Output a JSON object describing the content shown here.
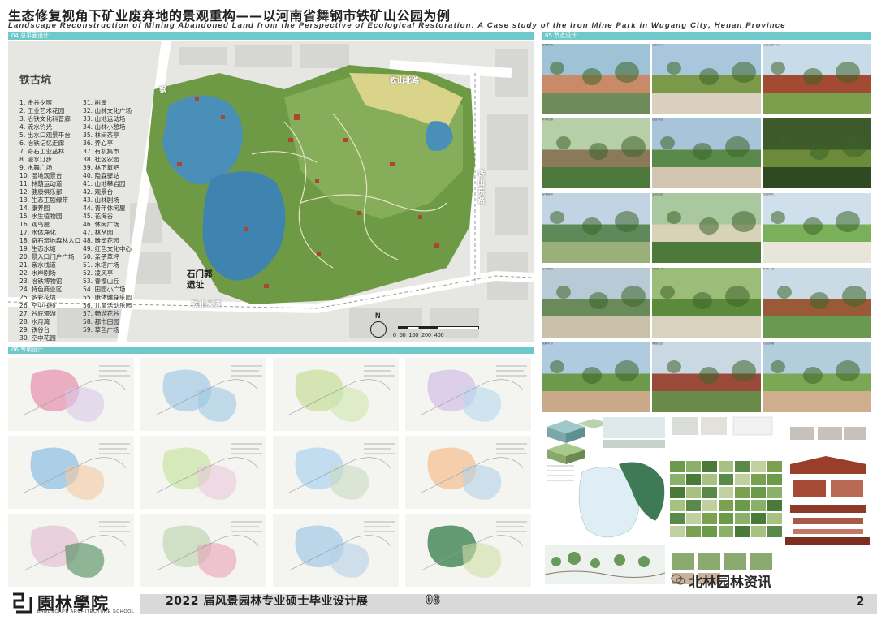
{
  "header": {
    "title_cn": "生态修复视角下矿业废弃地的景观重构——以河南省舞钢市铁矿山公园为例",
    "title_en": "Landscape Reconstruction of Mining Abandoned Land from the Perspective of Ecological Restoration: A Case study of the Iron Mine Park in Wugang City, Henan Province"
  },
  "sections": {
    "plan_title": "04 总平面设计",
    "photos_title": "05 节点设计",
    "special_title": "06 专项设计"
  },
  "plan": {
    "legend_title": "铁古坑",
    "legend_left": [
      "1. 金谷夕照",
      "2. 工业艺术花园",
      "3. 冶铁文化科普廊",
      "4. 流水钓光",
      "5. 出水口观景平台",
      "6. 冶铁记忆走廊",
      "7. 奇石工业丛林",
      "8. 漫水汀步",
      "9. 水舞广场",
      "10. 湿地观景台",
      "11. 林荫运动道",
      "12. 健康俱乐部",
      "13. 生态正剧绿带",
      "14. 康养园",
      "15. 水生植物园",
      "16. 观鸟屋",
      "17. 水体净化",
      "18. 奇石湿地森林入口",
      "19. 生态水塘",
      "20. 景入口门户广场",
      "21. 亲水栈道",
      "22. 水岸剧场",
      "23. 冶铁博物馆",
      "24. 特色商业区",
      "25. 多彩花境",
      "26. 空中栈桥",
      "27. 谷底漫游",
      "28. 水月湾",
      "29. 铁谷台",
      "30. 空中花园"
    ],
    "legend_right": [
      "31. 树屋",
      "32. 山林文化广场",
      "33. 山地运动场",
      "34. 山林小憩场",
      "35. 林间茶亭",
      "36. 养心亭",
      "37. 有机集市",
      "38. 社区农园",
      "39. 林下氧吧",
      "40. 隐森驿站",
      "41. 山地攀岩园",
      "42. 观景台",
      "43. 山林剧场",
      "44. 青年休闲屋",
      "45. 花海谷",
      "46. 休闲广场",
      "47. 林丛园",
      "48. 雕塑花园",
      "49. 红色文化中心",
      "50. 亲子草坪",
      "51. 水塔广场",
      "52. 凌风亭",
      "53. 春樱山丘",
      "54. 田园小广场",
      "55. 康体健身乐园",
      "56. 儿童活动乐园",
      "57. 畅游花谷",
      "58. 都市田园",
      "59. 草色广场"
    ],
    "roads": {
      "north": "铁山北路",
      "east": "铁山东路",
      "south": "铁山大道",
      "west": "钢"
    },
    "site_label": "石门郭\n遗址",
    "north_label": "N",
    "scale_ticks": "0 50 100   200        400"
  },
  "photo_captions": [
    "滨水步道",
    "山林之中",
    "红色文化中心",
    "水岸栈道",
    "社区农园",
    "林间小屋",
    "湿地森林",
    "生态花园",
    "田园风光",
    "空中栈桥",
    "林荫广场",
    "水塔广场",
    "观景平台",
    "雕塑花园",
    "花谷步道"
  ],
  "footer": {
    "logo": "園林學院",
    "logo_sub": "LANDSCAPE ARCHITECTURE SCHOOL",
    "exhibition": "2022 届风景园林专业硕士毕业设计展",
    "number": "08",
    "watermark": "北林园林资讯",
    "page": "2"
  },
  "colors": {
    "accent_teal": "#6fc8c9",
    "water": "#4a8fb8",
    "vegetation": "#5d8a3a",
    "building": "#b0452f"
  }
}
